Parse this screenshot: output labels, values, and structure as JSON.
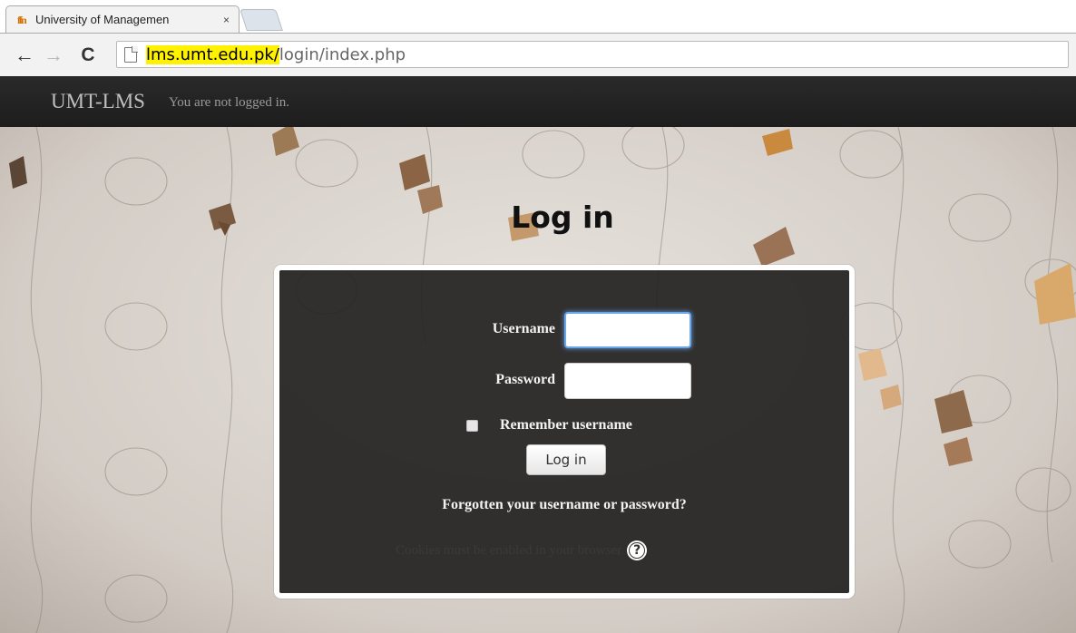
{
  "browser": {
    "tab": {
      "title": "University of Managemen",
      "favicon": "umt-logo-icon",
      "close_glyph": "×"
    },
    "toolbar": {
      "back_glyph": "←",
      "forward_glyph": "→",
      "reload_glyph": "C"
    },
    "address": {
      "host": "lms.umt.edu.pk/",
      "path": "login/index.php",
      "host_highlight_color": "#fff200"
    }
  },
  "navbar": {
    "brand": "UMT-LMS",
    "login_info": "You are not logged in."
  },
  "page": {
    "heading": "Log in"
  },
  "login_form": {
    "username_label": "Username",
    "username_value": "",
    "password_label": "Password",
    "password_value": "",
    "remember_label": "Remember username",
    "remember_checked": false,
    "submit_label": "Log in",
    "forgot_link": "Forgotten your username or password?",
    "cookies_notice": "Cookies must be enabled in your browser",
    "help_glyph": "?"
  },
  "colors": {
    "navbar_bg": "#1f1f1f",
    "panel_bg": "#242221",
    "input_focus": "#6aa7e6"
  }
}
